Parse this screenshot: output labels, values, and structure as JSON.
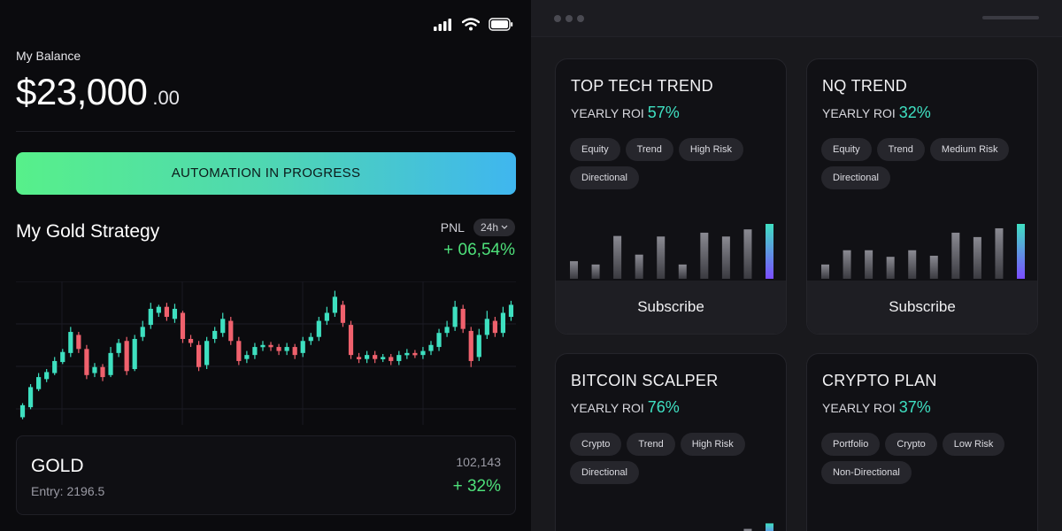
{
  "phone": {
    "balance_label": "My Balance",
    "balance_main": "$23,000",
    "balance_cents": ".00",
    "automation_label": "AUTOMATION IN PROGRESS",
    "strategy_title": "My Gold Strategy",
    "pnl_label": "PNL",
    "period": "24h",
    "pnl_value": "+ 06,54%",
    "asset": {
      "name": "GOLD",
      "entry": "Entry: 2196.5",
      "price": "102,143",
      "change": "+ 32%"
    }
  },
  "colors": {
    "up": "#3ee0c0",
    "down": "#f0616d",
    "accent_green": "#4ee07a",
    "roi_teal": "#3fe0c2",
    "gradient_start": "#57f08a",
    "gradient_end": "#3fb6ef"
  },
  "icons": [
    "signal-icon",
    "wifi-icon",
    "battery-icon",
    "chevron-down-icon"
  ],
  "candles": [
    {
      "o": 0,
      "c": 12,
      "h": 14,
      "l": -2
    },
    {
      "o": 10,
      "c": 30,
      "h": 33,
      "l": 8
    },
    {
      "o": 28,
      "c": 40,
      "h": 44,
      "l": 26
    },
    {
      "o": 38,
      "c": 45,
      "h": 48,
      "l": 35
    },
    {
      "o": 44,
      "c": 56,
      "h": 60,
      "l": 42
    },
    {
      "o": 55,
      "c": 65,
      "h": 68,
      "l": 53
    },
    {
      "o": 64,
      "c": 85,
      "h": 90,
      "l": 60
    },
    {
      "o": 82,
      "c": 68,
      "h": 85,
      "l": 64
    },
    {
      "o": 68,
      "c": 42,
      "h": 72,
      "l": 38
    },
    {
      "o": 44,
      "c": 50,
      "h": 54,
      "l": 40
    },
    {
      "o": 50,
      "c": 40,
      "h": 53,
      "l": 36
    },
    {
      "o": 42,
      "c": 64,
      "h": 70,
      "l": 40
    },
    {
      "o": 64,
      "c": 74,
      "h": 78,
      "l": 60
    },
    {
      "o": 76,
      "c": 46,
      "h": 80,
      "l": 42
    },
    {
      "o": 48,
      "c": 78,
      "h": 82,
      "l": 46
    },
    {
      "o": 80,
      "c": 90,
      "h": 96,
      "l": 76
    },
    {
      "o": 92,
      "c": 108,
      "h": 114,
      "l": 88
    },
    {
      "o": 104,
      "c": 110,
      "h": 112,
      "l": 100
    },
    {
      "o": 110,
      "c": 100,
      "h": 114,
      "l": 96
    },
    {
      "o": 98,
      "c": 108,
      "h": 113,
      "l": 94
    },
    {
      "o": 104,
      "c": 78,
      "h": 106,
      "l": 74
    },
    {
      "o": 78,
      "c": 74,
      "h": 82,
      "l": 70
    },
    {
      "o": 72,
      "c": 50,
      "h": 76,
      "l": 46
    },
    {
      "o": 52,
      "c": 76,
      "h": 80,
      "l": 48
    },
    {
      "o": 78,
      "c": 86,
      "h": 90,
      "l": 74
    },
    {
      "o": 84,
      "c": 98,
      "h": 104,
      "l": 80
    },
    {
      "o": 96,
      "c": 76,
      "h": 100,
      "l": 72
    },
    {
      "o": 76,
      "c": 56,
      "h": 80,
      "l": 52
    },
    {
      "o": 58,
      "c": 62,
      "h": 66,
      "l": 54
    },
    {
      "o": 62,
      "c": 70,
      "h": 74,
      "l": 58
    },
    {
      "o": 70,
      "c": 72,
      "h": 76,
      "l": 66
    },
    {
      "o": 72,
      "c": 70,
      "h": 75,
      "l": 66
    },
    {
      "o": 70,
      "c": 66,
      "h": 73,
      "l": 62
    },
    {
      "o": 66,
      "c": 70,
      "h": 74,
      "l": 62
    },
    {
      "o": 70,
      "c": 62,
      "h": 73,
      "l": 58
    },
    {
      "o": 64,
      "c": 76,
      "h": 80,
      "l": 60
    },
    {
      "o": 76,
      "c": 80,
      "h": 84,
      "l": 72
    },
    {
      "o": 80,
      "c": 96,
      "h": 100,
      "l": 76
    },
    {
      "o": 96,
      "c": 104,
      "h": 110,
      "l": 92
    },
    {
      "o": 104,
      "c": 120,
      "h": 126,
      "l": 100
    },
    {
      "o": 112,
      "c": 94,
      "h": 116,
      "l": 90
    },
    {
      "o": 92,
      "c": 62,
      "h": 96,
      "l": 58
    },
    {
      "o": 60,
      "c": 58,
      "h": 64,
      "l": 54
    },
    {
      "o": 58,
      "c": 62,
      "h": 66,
      "l": 54
    },
    {
      "o": 62,
      "c": 58,
      "h": 66,
      "l": 54
    },
    {
      "o": 58,
      "c": 60,
      "h": 63,
      "l": 55
    },
    {
      "o": 60,
      "c": 56,
      "h": 63,
      "l": 52
    },
    {
      "o": 56,
      "c": 62,
      "h": 66,
      "l": 52
    },
    {
      "o": 62,
      "c": 64,
      "h": 68,
      "l": 58
    },
    {
      "o": 64,
      "c": 62,
      "h": 67,
      "l": 59
    },
    {
      "o": 62,
      "c": 66,
      "h": 70,
      "l": 58
    },
    {
      "o": 66,
      "c": 72,
      "h": 76,
      "l": 62
    },
    {
      "o": 70,
      "c": 84,
      "h": 88,
      "l": 66
    },
    {
      "o": 84,
      "c": 90,
      "h": 96,
      "l": 80
    },
    {
      "o": 90,
      "c": 110,
      "h": 116,
      "l": 86
    },
    {
      "o": 108,
      "c": 88,
      "h": 112,
      "l": 84
    },
    {
      "o": 86,
      "c": 56,
      "h": 90,
      "l": 50
    },
    {
      "o": 60,
      "c": 82,
      "h": 88,
      "l": 56
    },
    {
      "o": 82,
      "c": 98,
      "h": 106,
      "l": 78
    },
    {
      "o": 96,
      "c": 84,
      "h": 100,
      "l": 80
    },
    {
      "o": 84,
      "c": 104,
      "h": 110,
      "l": 80
    },
    {
      "o": 100,
      "c": 112,
      "h": 116,
      "l": 96
    }
  ],
  "cards": [
    {
      "title": "TOP TECH TREND",
      "roi_label": "YEARLY ROI",
      "roi_value": "57%",
      "tags": [
        "Equity",
        "Trend",
        "High Risk",
        "Directional"
      ],
      "subscribe_label": "Subscribe",
      "bars": [
        0.32,
        0.26,
        0.78,
        0.44,
        0.77,
        0.26,
        0.84,
        0.77,
        0.9,
        1.0
      ]
    },
    {
      "title": "NQ TREND",
      "roi_label": "YEARLY ROI",
      "roi_value": "32%",
      "tags": [
        "Equity",
        "Trend",
        "Medium Risk",
        "Directional"
      ],
      "subscribe_label": "Subscribe",
      "bars": [
        0.26,
        0.52,
        0.52,
        0.4,
        0.52,
        0.42,
        0.84,
        0.76,
        0.92,
        1.0
      ]
    },
    {
      "title": "BITCOIN SCALPER",
      "roi_label": "YEARLY ROI",
      "roi_value": "76%",
      "tags": [
        "Crypto",
        "Trend",
        "High Risk",
        "Directional"
      ],
      "subscribe_label": "",
      "bars": [
        0,
        0,
        0,
        0,
        0,
        0.05,
        0.1,
        0.05,
        0.2,
        0.3
      ]
    },
    {
      "title": "CRYPTO PLAN",
      "roi_label": "YEARLY ROI",
      "roi_value": "37%",
      "tags": [
        "Portfolio",
        "Crypto",
        "Low Risk",
        "Non-Directional"
      ],
      "subscribe_label": "",
      "bars": []
    }
  ]
}
